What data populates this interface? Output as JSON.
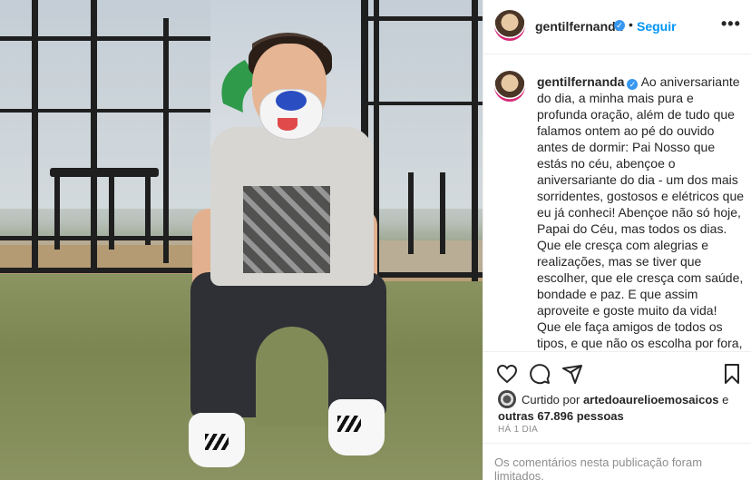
{
  "post": {
    "username": "gentilfernanda",
    "follow_label": "Seguir",
    "separator": "•",
    "more_label": "•••",
    "verified_glyph": "✓",
    "caption": "Ao aniversariante do dia, a minha mais pura e profunda oração, além de tudo que falamos ontem ao pé do ouvido antes de dormir: Pai Nosso que estás no céu, abençoe o aniversariante do dia - um dos mais sorridentes, gostosos e elétricos que eu já conheci! Abençoe não só hoje, Papai do Céu, mas todos os dias. Que ele cresça com alegrias e realizações, mas se tiver que escolher, que ele cresça com saúde, bondade e paz. E que assim aproveite e goste muito da vida! Que ele faça amigos de todos os tipos, e que não os escolha por fora, mas sim por dentro - e que até se decepcione com alguns deles para entender que os de verdade mesmo são poucos. Que ele brinque, dance, cante e se divirta...",
    "liked_prefix": "Curtido por",
    "liked_by": "artedoaurelioemosaicos",
    "liked_middle": "e",
    "liked_others": "outras 67.896 pessoas",
    "time_ago": "HÁ 1 DIA",
    "comments_limited": "Os comentários nesta publicação foram limitados."
  },
  "icons": {
    "like": "heart-icon",
    "comment": "comment-icon",
    "share": "share-icon",
    "save": "bookmark-icon"
  },
  "colors": {
    "accent": "#0095f6",
    "verified": "#3897f0",
    "muted": "#8e8e8e",
    "text": "#262626"
  }
}
